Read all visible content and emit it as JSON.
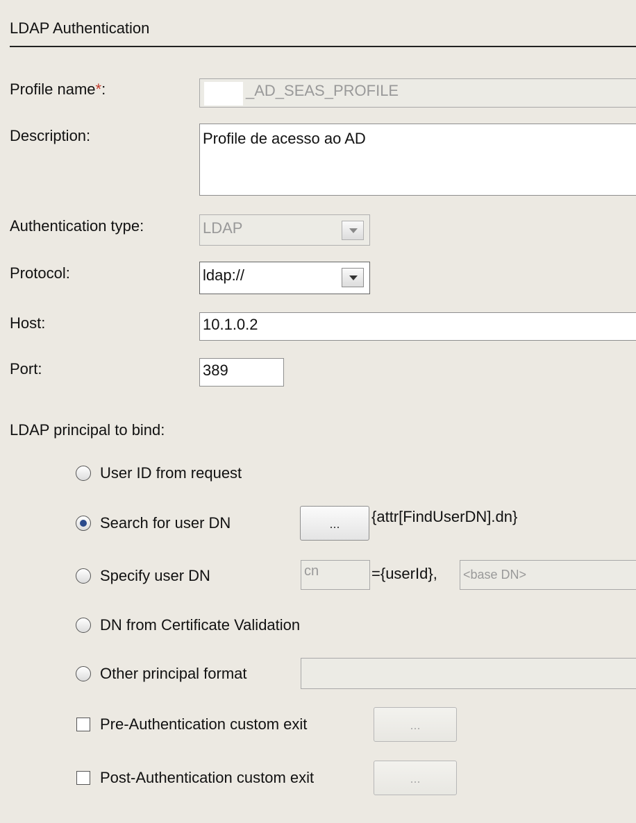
{
  "section": {
    "title": "LDAP Authentication"
  },
  "form": {
    "profile_name_label": "Profile name",
    "required_mark": "*",
    "profile_name_colon": ":",
    "profile_name_value": "_AD_SEAS_PROFILE",
    "description_label": "Description:",
    "description_value": "Profile de acesso ao AD",
    "auth_type_label": "Authentication type:",
    "auth_type_value": "LDAP",
    "protocol_label": "Protocol:",
    "protocol_value": "ldap://",
    "host_label": "Host:",
    "host_value": "10.1.0.2",
    "port_label": "Port:",
    "port_value": "389"
  },
  "principal": {
    "label": "LDAP principal to bind:",
    "options": [
      {
        "label": "User ID from request",
        "checked": false
      },
      {
        "label": "Search for user DN",
        "checked": true
      },
      {
        "label": "Specify user DN",
        "checked": false
      },
      {
        "label": "DN from Certificate Validation",
        "checked": false
      },
      {
        "label": "Other principal format",
        "checked": false
      }
    ],
    "search_button": "...",
    "search_value": "{attr[FindUserDN].dn}",
    "specify_attr_placeholder": "cn",
    "specify_suffix": "={userId},",
    "specify_base_placeholder": "<base DN>"
  },
  "exits": {
    "pre_label": "Pre-Authentication custom exit",
    "pre_button": "...",
    "post_label": "Post-Authentication custom exit",
    "post_button": "..."
  }
}
